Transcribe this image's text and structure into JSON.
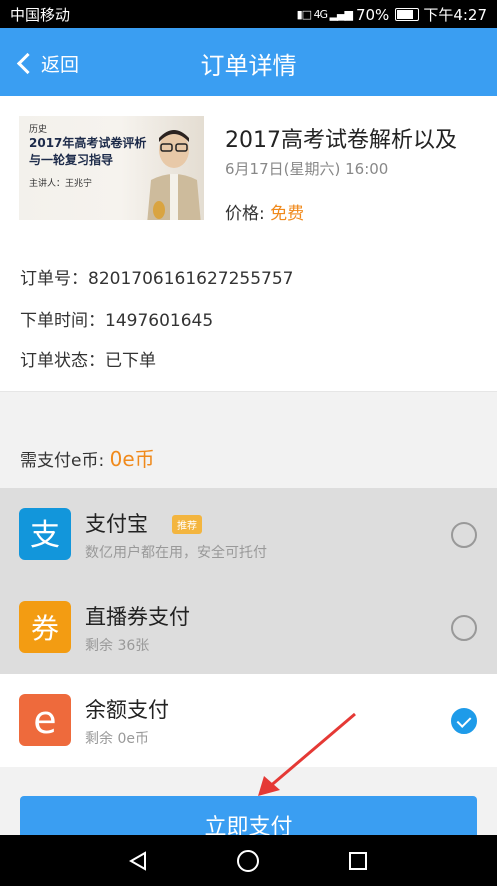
{
  "status_bar": {
    "carrier": "中国移动",
    "signal_text": "4G",
    "battery": "70%",
    "time": "下午4:27"
  },
  "nav": {
    "back_label": "返回",
    "title": "订单详情"
  },
  "course": {
    "thumb_subject": "历史",
    "thumb_line1": "2017年高考试卷评析",
    "thumb_line2": "与一轮复习指导",
    "thumb_teacher": "主讲人：王兆宁",
    "title": "2017高考试卷解析以及",
    "time": "6月17日(星期六) 16:00",
    "price_label": "价格:",
    "price_value": "免费"
  },
  "order": {
    "number_label": "订单号：",
    "number_value": "820170616162725575​7",
    "time_label": "下单时间：",
    "time_value": "1497601645",
    "status_label": "订单状态：",
    "status_value": "已下单"
  },
  "payment": {
    "due_label": "需支付e币:",
    "due_amount": "0e币",
    "methods": [
      {
        "name": "支付宝",
        "badge": "推荐",
        "desc": "数亿用户都在用，安全可托付",
        "selected": false,
        "icon": "alipay-icon"
      },
      {
        "name": "直播券支付",
        "desc": "剩余 36张",
        "selected": false,
        "icon": "ticket-icon",
        "icon_glyph": "券"
      },
      {
        "name": "余额支付",
        "desc": "剩余 0e币",
        "selected": true,
        "icon": "balance-icon",
        "icon_glyph": "e"
      }
    ],
    "submit_label": "立即支付"
  },
  "colors": {
    "primary": "#3a9ef2",
    "accent_orange": "#f08a1c",
    "annotation_arrow": "#e53935"
  }
}
